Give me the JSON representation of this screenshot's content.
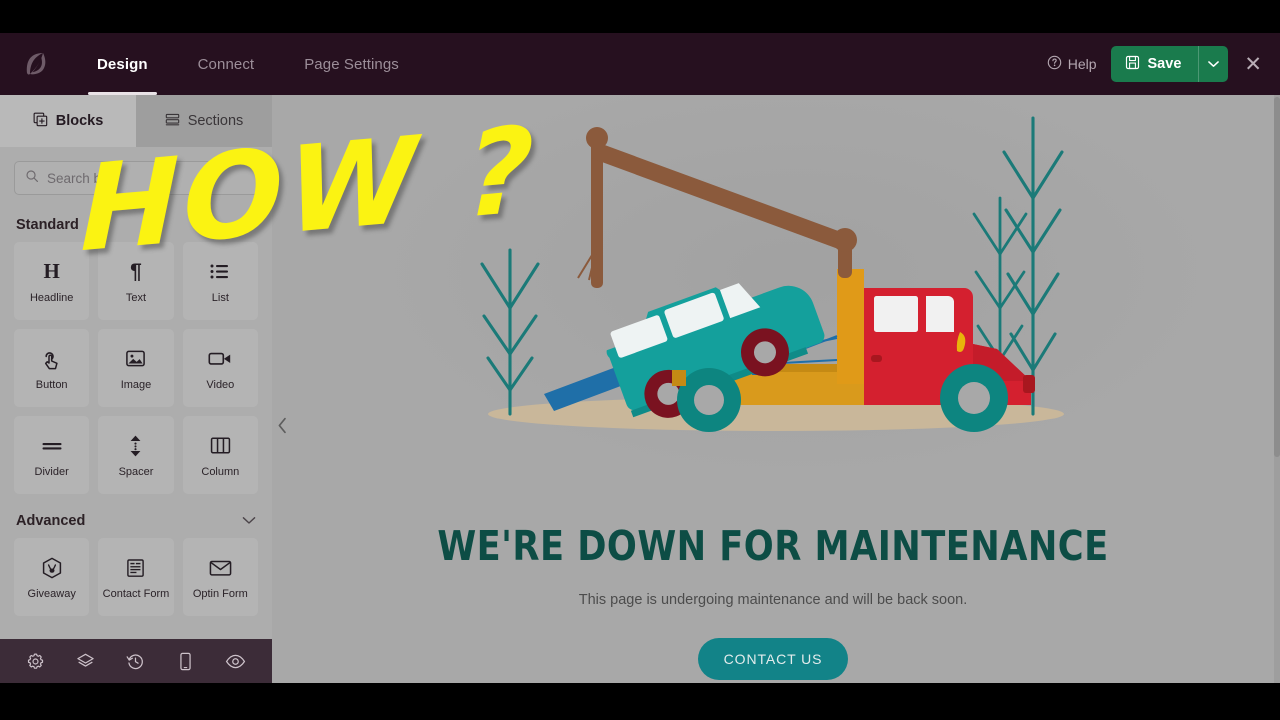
{
  "app": {
    "logo_icon": "leaf-logo-icon",
    "nav_tabs": [
      {
        "label": "Design",
        "active": true
      },
      {
        "label": "Connect",
        "active": false
      },
      {
        "label": "Page Settings",
        "active": false
      }
    ],
    "help_label": "Help",
    "help_icon": "help-circle-icon",
    "save_label": "Save",
    "save_icon": "save-disk-icon",
    "save_caret_icon": "chevron-down-icon",
    "close_icon": "close-x-icon",
    "accent_green": "#1a7b4d",
    "topbar_bg": "#26101f"
  },
  "sidebar": {
    "panel_tabs": [
      {
        "label": "Blocks",
        "icon": "blocks-grid-icon",
        "active": true
      },
      {
        "label": "Sections",
        "icon": "sections-stack-icon",
        "active": false
      }
    ],
    "search": {
      "placeholder": "Search blo",
      "icon": "search-icon"
    },
    "groups": [
      {
        "title": "Standard",
        "chevron_icon": "chevron-down-icon",
        "blocks": [
          {
            "label": "Headline",
            "icon": "headline-h-icon"
          },
          {
            "label": "Text",
            "icon": "paragraph-pilcrow-icon"
          },
          {
            "label": "List",
            "icon": "list-icon"
          },
          {
            "label": "Button",
            "icon": "button-click-icon"
          },
          {
            "label": "Image",
            "icon": "image-icon"
          },
          {
            "label": "Video",
            "icon": "video-camera-icon"
          },
          {
            "label": "Divider",
            "icon": "divider-icon"
          },
          {
            "label": "Spacer",
            "icon": "spacer-arrows-icon"
          },
          {
            "label": "Column",
            "icon": "columns-icon"
          }
        ]
      },
      {
        "title": "Advanced",
        "chevron_icon": "chevron-down-icon",
        "blocks": [
          {
            "label": "Giveaway",
            "icon": "giveaway-gift-icon"
          },
          {
            "label": "Contact Form",
            "icon": "contact-form-icon"
          },
          {
            "label": "Optin Form",
            "icon": "envelope-icon"
          }
        ]
      }
    ],
    "bottom_tools": [
      {
        "icon": "gear-icon",
        "name": "settings"
      },
      {
        "icon": "layers-icon",
        "name": "layers"
      },
      {
        "icon": "history-clock-icon",
        "name": "revision-history"
      },
      {
        "icon": "mobile-device-icon",
        "name": "device-preview"
      },
      {
        "icon": "eye-icon",
        "name": "preview"
      }
    ],
    "bottombar_bg": "#3c2c38"
  },
  "canvas": {
    "collapse_icon": "chevron-left-icon",
    "background": "#a8a8a8",
    "maintenance": {
      "title": "WE'RE DOWN FOR MAINTENANCE",
      "subtitle": "This page is undergoing maintenance and will be back soon.",
      "button_label": "CONTACT US",
      "title_color": "#0d4d45",
      "button_color": "#128388"
    },
    "illustration": {
      "name": "tow-truck-illustration",
      "colors": {
        "car": "#14a09c",
        "car_tire": "#7a1220",
        "truck_body": "#d4202f",
        "truck_bed": "#d99a1c",
        "truck_tire": "#0d8580",
        "crane_arm": "#8b5a3c",
        "ramp": "#1f6fa8",
        "ground": "#c9b79a",
        "plant": "#1b7a78"
      }
    }
  },
  "overlay": {
    "text": "HOW ?",
    "color": "#fbf312"
  }
}
